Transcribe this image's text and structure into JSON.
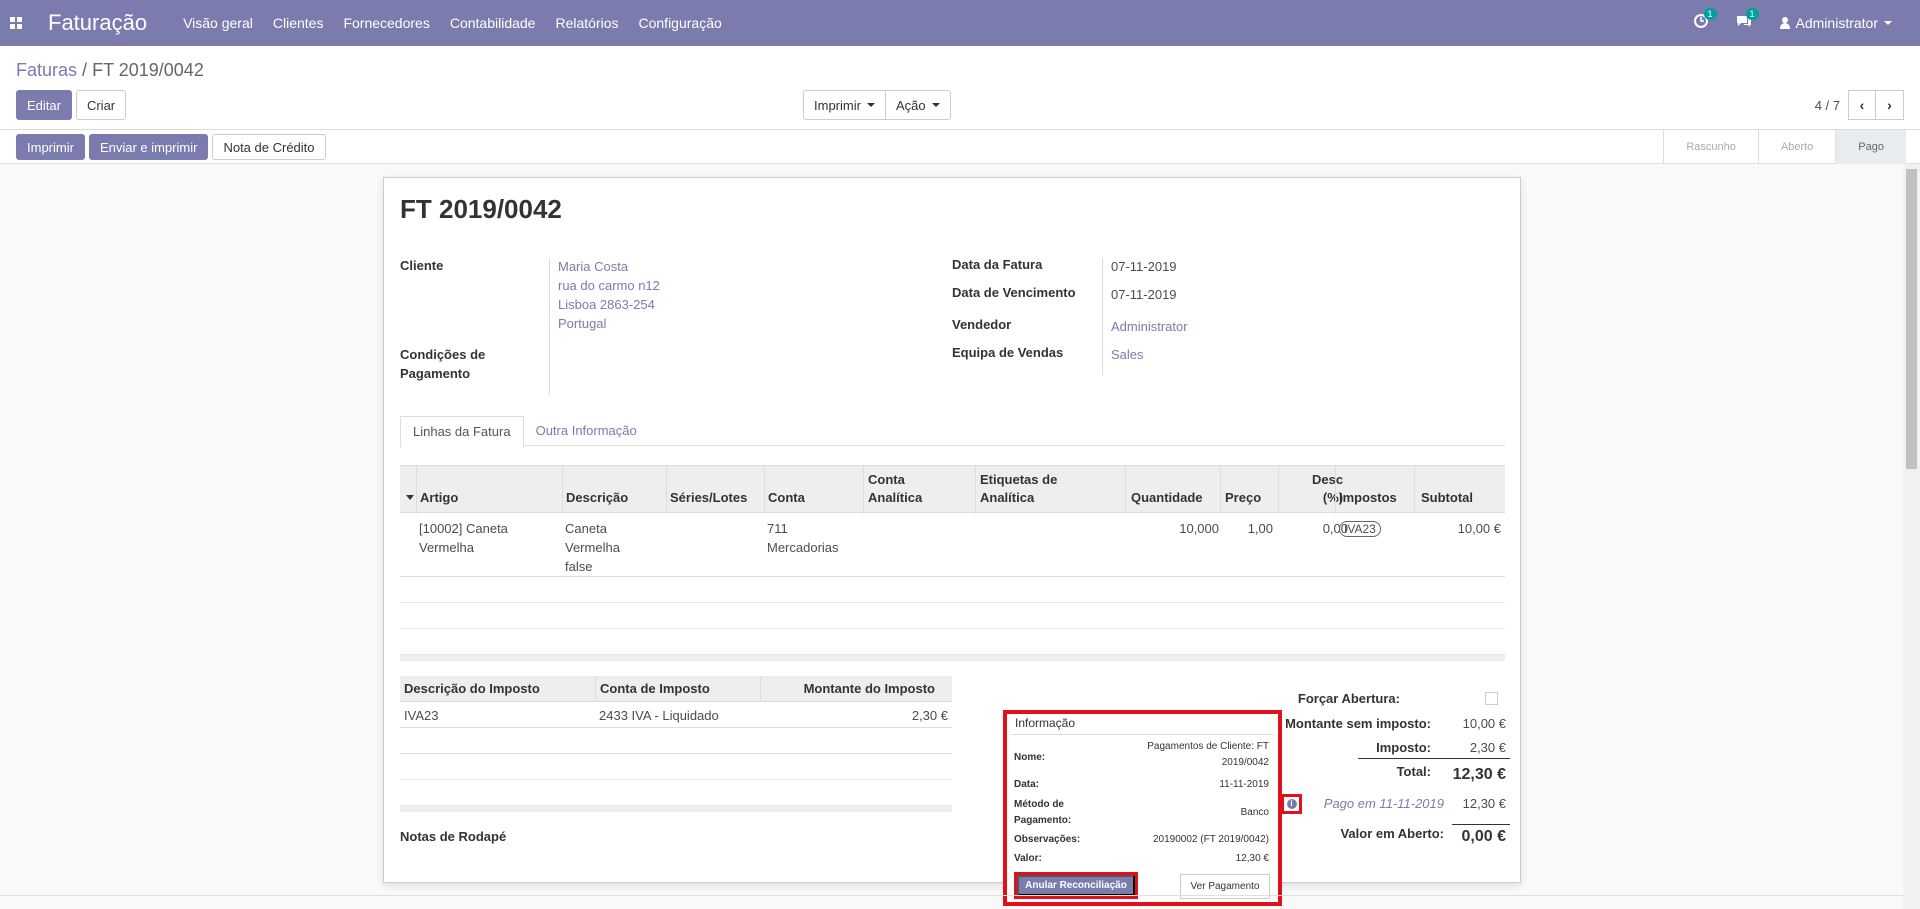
{
  "navbar": {
    "brand": "Faturação",
    "menu": [
      "Visão geral",
      "Clientes",
      "Fornecedores",
      "Contabilidade",
      "Relatórios",
      "Configuração"
    ],
    "activity_badge": "1",
    "messages_badge": "1",
    "user": "Administrator",
    "color": "#7c7bad"
  },
  "breadcrumb": {
    "parent": "Faturas",
    "separator": "/",
    "current": "FT 2019/0042"
  },
  "control_panel": {
    "edit_label": "Editar",
    "create_label": "Criar",
    "print_label": "Imprimir",
    "action_label": "Ação",
    "pager_value": "4 / 7"
  },
  "statusbar": {
    "print_label": "Imprimir",
    "send_print_label": "Enviar e imprimir",
    "credit_note_label": "Nota de Crédito",
    "stages": [
      "Rascunho",
      "Aberto",
      "Pago"
    ],
    "active_stage": "Pago"
  },
  "invoice": {
    "title": "FT 2019/0042",
    "customer_label": "Cliente",
    "customer_lines": [
      "Maria Costa",
      "rua do carmo n12",
      "Lisboa 2863-254",
      "Portugal"
    ],
    "payment_terms_label_1": "Condições de",
    "payment_terms_label_2": "Pagamento",
    "invoice_date_label": "Data da Fatura",
    "invoice_date": "07-11-2019",
    "due_date_label": "Data de Vencimento",
    "due_date": "07-11-2019",
    "salesperson_label": "Vendedor",
    "salesperson": "Administrator",
    "sales_team_label": "Equipa de Vendas",
    "sales_team": "Sales"
  },
  "tabs": {
    "lines": "Linhas da Fatura",
    "other": "Outra Informação"
  },
  "lines": {
    "headers": {
      "artigo": "Artigo",
      "descricao": "Descrição",
      "series": "Séries/Lotes",
      "conta": "Conta",
      "conta_analitica_1": "Conta",
      "conta_analitica_2": "Analítica",
      "etiquetas_1": "Etiquetas de",
      "etiquetas_2": "Analítica",
      "quantidade": "Quantidade",
      "preco": "Preço",
      "desc_1": "Desc",
      "desc_2": "(%)",
      "impostos": "Impostos",
      "subtotal": "Subtotal"
    },
    "row": {
      "artigo_1": "[10002] Caneta",
      "artigo_2": "Vermelha",
      "descricao_1": "Caneta",
      "descricao_2": "Vermelha",
      "descricao_3": "false",
      "conta_1": "711",
      "conta_2": "Mercadorias",
      "quantidade": "10,000",
      "preco": "1,00",
      "desc": "0,00",
      "imposto": "IVA23",
      "subtotal": "10,00 €"
    }
  },
  "taxes": {
    "headers": {
      "descricao": "Descrição do Imposto",
      "conta": "Conta de Imposto",
      "montante": "Montante do Imposto"
    },
    "row": {
      "descricao": "IVA23",
      "conta": "2433 IVA - Liquidado",
      "montante": "2,30 €"
    }
  },
  "notes_label": "Notas de Rodapé",
  "totals": {
    "force_open_label": "Forçar Abertura:",
    "untaxed_label": "Montante sem imposto:",
    "untaxed": "10,00 €",
    "tax_label": "Imposto:",
    "tax": "2,30 €",
    "total_label": "Total:",
    "total": "12,30 €",
    "paid_label": "Pago em 11-11-2019",
    "paid": "12,30 €",
    "residual_label": "Valor em Aberto:",
    "residual": "0,00 €"
  },
  "popover": {
    "title": "Informação",
    "name_label": "Nome:",
    "name_1": "Pagamentos de Cliente: FT",
    "name_2": "2019/0042",
    "date_label": "Data:",
    "date": "11-11-2019",
    "method_label_1": "Método de",
    "method_label_2": "Pagamento:",
    "method": "Banco",
    "notes_label": "Observações:",
    "notes": "20190002 (FT 2019/0042)",
    "value_label": "Valor:",
    "value": "12,30 €",
    "unreconcile_label": "Anular Reconciliação",
    "view_payment_label": "Ver Pagamento",
    "highlight_color": "#e0111b"
  }
}
